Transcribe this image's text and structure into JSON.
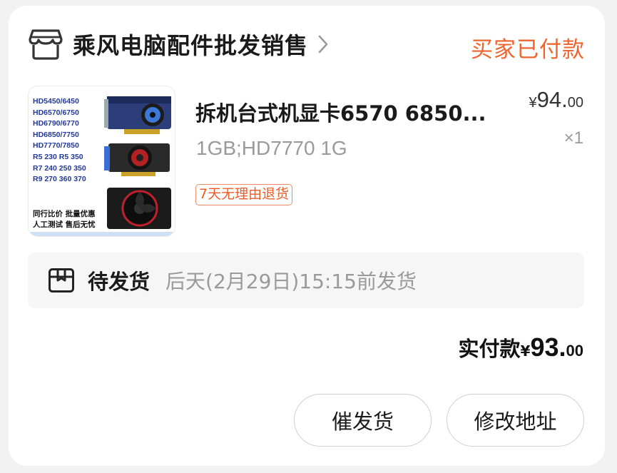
{
  "store": {
    "name": "乘风电脑配件批发销售",
    "icon": "store-icon"
  },
  "order": {
    "status": "买家已付款"
  },
  "product": {
    "title": "拆机台式机显卡6570 6850...",
    "spec": "1GB;HD7770 1G",
    "return_badge": "7天无理由退货",
    "price_currency": "¥",
    "price_int": "94.",
    "price_dec": "00",
    "quantity": "×1",
    "thumbnail": {
      "models": [
        "HD5450/6450",
        "HD6570/6750",
        "HD6790/6770",
        "HD6850/7750",
        "HD7770/7850",
        "R5 230  R5 350",
        "R7 240 250 350",
        "R9 270 360 370"
      ],
      "footer_line1": "同行比价  批量优惠",
      "footer_line2": "人工测试  售后无忧"
    }
  },
  "shipping": {
    "icon": "box-icon",
    "status": "待发货",
    "detail": "后天(2月29日)15:15前发货"
  },
  "total": {
    "label": "实付款",
    "currency": "¥",
    "int": "93.",
    "dec": "00"
  },
  "actions": {
    "urge_label": "催发货",
    "address_label": "修改地址"
  },
  "colors": {
    "accent": "#f0642e",
    "muted_text": "#9a9a9a"
  }
}
